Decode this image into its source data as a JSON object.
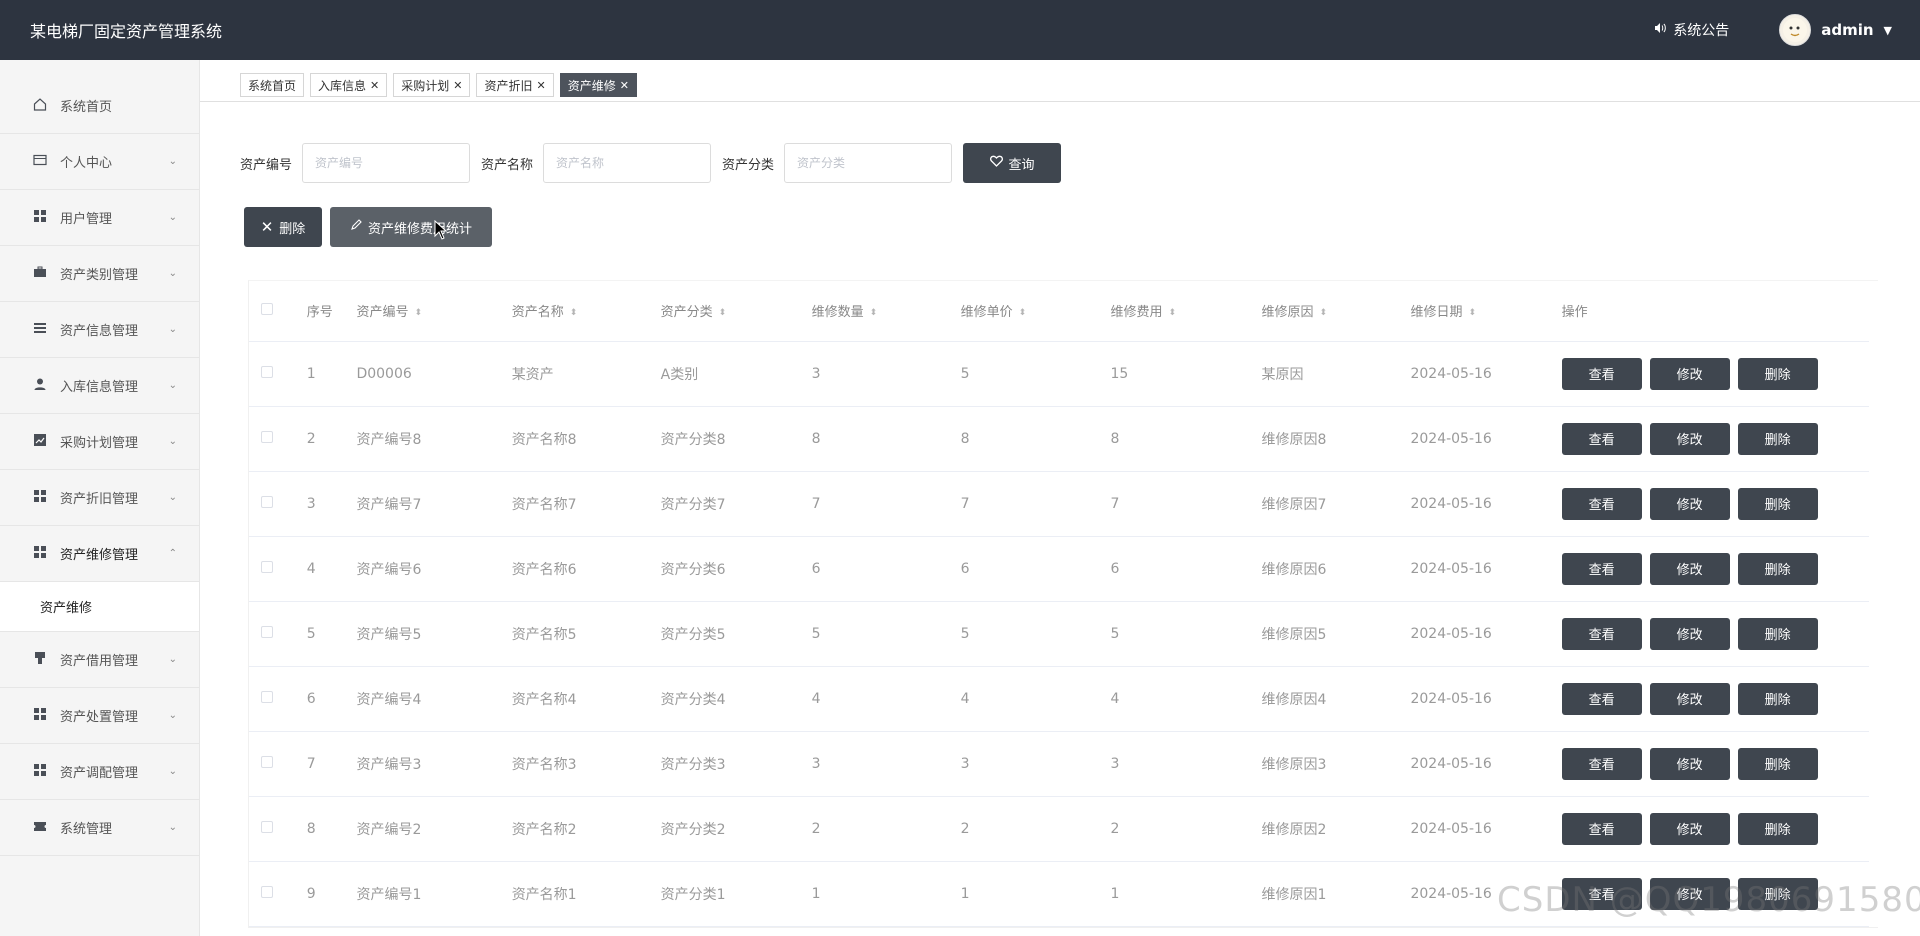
{
  "header": {
    "title": "某电梯厂固定资产管理系统",
    "notice_label": "系统公告",
    "user_name": "admin"
  },
  "sidebar": {
    "items": [
      {
        "label": "系统首页",
        "icon": "home-icon",
        "arrow": ""
      },
      {
        "label": "个人中心",
        "icon": "card-icon",
        "arrow": "⌄"
      },
      {
        "label": "用户管理",
        "icon": "grid-icon",
        "arrow": "⌄"
      },
      {
        "label": "资产类别管理",
        "icon": "briefcase-icon",
        "arrow": "⌄"
      },
      {
        "label": "资产信息管理",
        "icon": "list-icon",
        "arrow": "⌄"
      },
      {
        "label": "入库信息管理",
        "icon": "user-icon",
        "arrow": "⌄"
      },
      {
        "label": "采购计划管理",
        "icon": "chart-icon",
        "arrow": "⌄"
      },
      {
        "label": "资产折旧管理",
        "icon": "grid-icon",
        "arrow": "⌄"
      },
      {
        "label": "资产维修管理",
        "icon": "grid-icon",
        "arrow": "⌃"
      },
      {
        "label": "资产借用管理",
        "icon": "pin-icon",
        "arrow": "⌄"
      },
      {
        "label": "资产处置管理",
        "icon": "grid-icon",
        "arrow": "⌄"
      },
      {
        "label": "资产调配管理",
        "icon": "grid-icon",
        "arrow": "⌄"
      },
      {
        "label": "系统管理",
        "icon": "ticket-icon",
        "arrow": "⌄"
      }
    ],
    "sub_item": "资产维修"
  },
  "tabs": [
    {
      "label": "系统首页",
      "closable": false
    },
    {
      "label": "入库信息",
      "closable": true
    },
    {
      "label": "采购计划",
      "closable": true
    },
    {
      "label": "资产折旧",
      "closable": true
    },
    {
      "label": "资产维修",
      "closable": true
    }
  ],
  "search": {
    "code_label": "资产编号",
    "code_placeholder": "资产编号",
    "name_label": "资产名称",
    "name_placeholder": "资产名称",
    "category_label": "资产分类",
    "category_placeholder": "资产分类",
    "query_button": "查询"
  },
  "actions": {
    "delete_button": "删除",
    "stats_button": "资产维修费用统计"
  },
  "table": {
    "headers": [
      "序号",
      "资产编号",
      "资产名称",
      "资产分类",
      "维修数量",
      "维修单价",
      "维修费用",
      "维修原因",
      "维修日期",
      "操作"
    ],
    "rows": [
      [
        "1",
        "D00006",
        "某资产",
        "A类别",
        "3",
        "5",
        "15",
        "某原因",
        "2024-05-16"
      ],
      [
        "2",
        "资产编号8",
        "资产名称8",
        "资产分类8",
        "8",
        "8",
        "8",
        "维修原因8",
        "2024-05-16"
      ],
      [
        "3",
        "资产编号7",
        "资产名称7",
        "资产分类7",
        "7",
        "7",
        "7",
        "维修原因7",
        "2024-05-16"
      ],
      [
        "4",
        "资产编号6",
        "资产名称6",
        "资产分类6",
        "6",
        "6",
        "6",
        "维修原因6",
        "2024-05-16"
      ],
      [
        "5",
        "资产编号5",
        "资产名称5",
        "资产分类5",
        "5",
        "5",
        "5",
        "维修原因5",
        "2024-05-16"
      ],
      [
        "6",
        "资产编号4",
        "资产名称4",
        "资产分类4",
        "4",
        "4",
        "4",
        "维修原因4",
        "2024-05-16"
      ],
      [
        "7",
        "资产编号3",
        "资产名称3",
        "资产分类3",
        "3",
        "3",
        "3",
        "维修原因3",
        "2024-05-16"
      ],
      [
        "8",
        "资产编号2",
        "资产名称2",
        "资产分类2",
        "2",
        "2",
        "2",
        "维修原因2",
        "2024-05-16"
      ],
      [
        "9",
        "资产编号1",
        "资产名称1",
        "资产分类1",
        "1",
        "1",
        "1",
        "维修原因1",
        "2024-05-16"
      ]
    ],
    "row_buttons": [
      "查看",
      "修改",
      "删除"
    ]
  },
  "watermark": "CSDN @QQ1980691580",
  "colors": {
    "header_bg": "#2d3440",
    "button_dark": "#3f464f",
    "active_tab": "#4d535c"
  }
}
